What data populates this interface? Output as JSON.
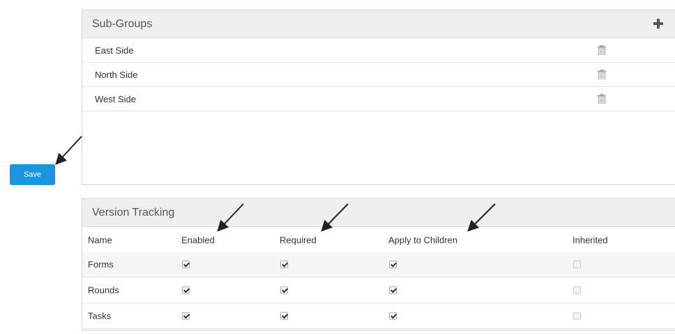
{
  "subgroups": {
    "title": "Sub-Groups",
    "add_icon": "plus-icon",
    "rows": [
      {
        "name": "East Side"
      },
      {
        "name": "North Side"
      },
      {
        "name": "West Side"
      }
    ]
  },
  "save_label": "Save",
  "version_tracking": {
    "title": "Version Tracking",
    "columns": [
      "Name",
      "Enabled",
      "Required",
      "Apply to Children",
      "Inherited"
    ],
    "rows": [
      {
        "name": "Forms",
        "enabled": true,
        "required": true,
        "apply_to_children": true,
        "inherited": false
      },
      {
        "name": "Rounds",
        "enabled": true,
        "required": true,
        "apply_to_children": true,
        "inherited": false
      },
      {
        "name": "Tasks",
        "enabled": true,
        "required": true,
        "apply_to_children": true,
        "inherited": false
      }
    ]
  },
  "colors": {
    "save_button": "#1a95dd",
    "header_bg": "#efefef",
    "arrow": "#222222"
  }
}
